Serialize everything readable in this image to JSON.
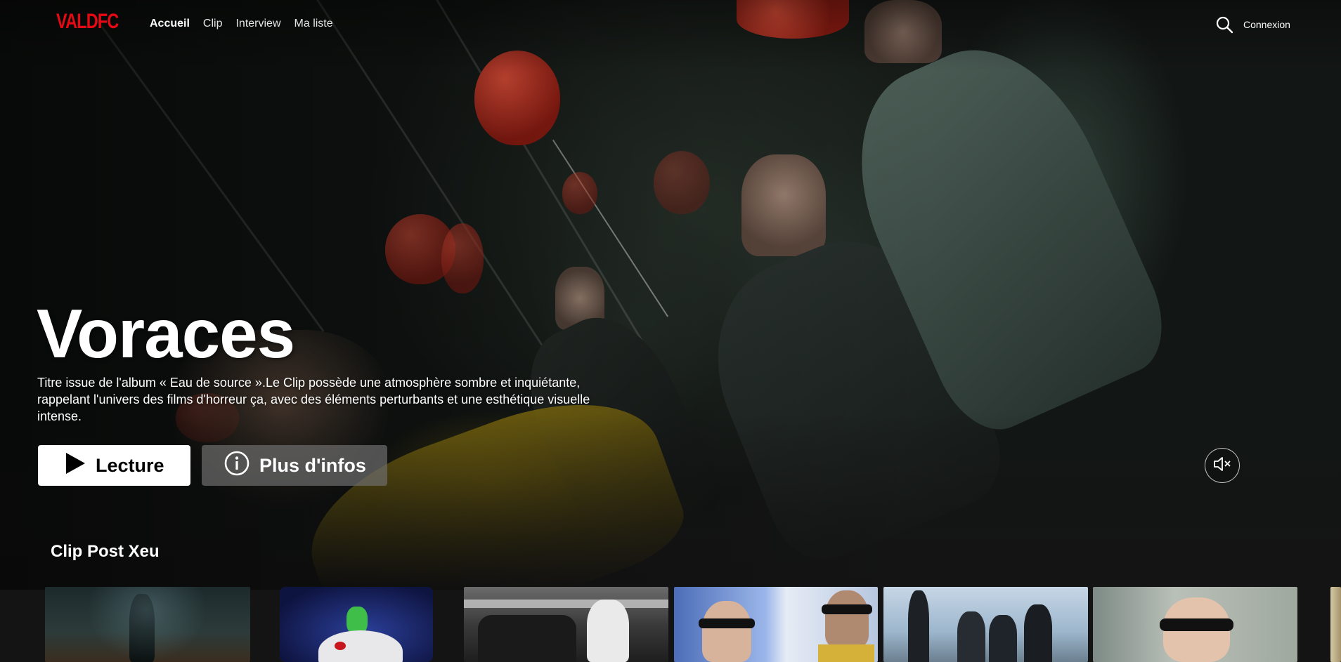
{
  "app": {
    "logo": "VALDFC",
    "accent_color": "#e50914"
  },
  "nav": {
    "links": [
      {
        "label": "Accueil",
        "active": true
      },
      {
        "label": "Clip",
        "active": false
      },
      {
        "label": "Interview",
        "active": false
      },
      {
        "label": "Ma liste",
        "active": false
      }
    ],
    "search_icon": "search-icon",
    "login_label": "Connexion"
  },
  "billboard": {
    "title": "Voraces",
    "synopsis": "Titre issue de l'album « Eau de source ».Le Clip possède une atmosphère sombre et inquiétante, rappelant l'univers des films d'horreur ça, avec des éléments perturbants et une esthétique visuelle intense.",
    "play_label": "Lecture",
    "info_label": "Plus d'infos",
    "mute_icon": "volume-muted-icon"
  },
  "row": {
    "title": "Clip Post Xeu",
    "tiles": [
      {
        "thumb": "silhouette-window"
      },
      {
        "thumb": "figure-on-skull"
      },
      {
        "thumb": "group-black-white"
      },
      {
        "thumb": "two-men-sunglasses"
      },
      {
        "thumb": "group-silhouettes-sky"
      },
      {
        "thumb": "man-sunglasses"
      },
      {
        "thumb": "partial-tile"
      }
    ]
  }
}
